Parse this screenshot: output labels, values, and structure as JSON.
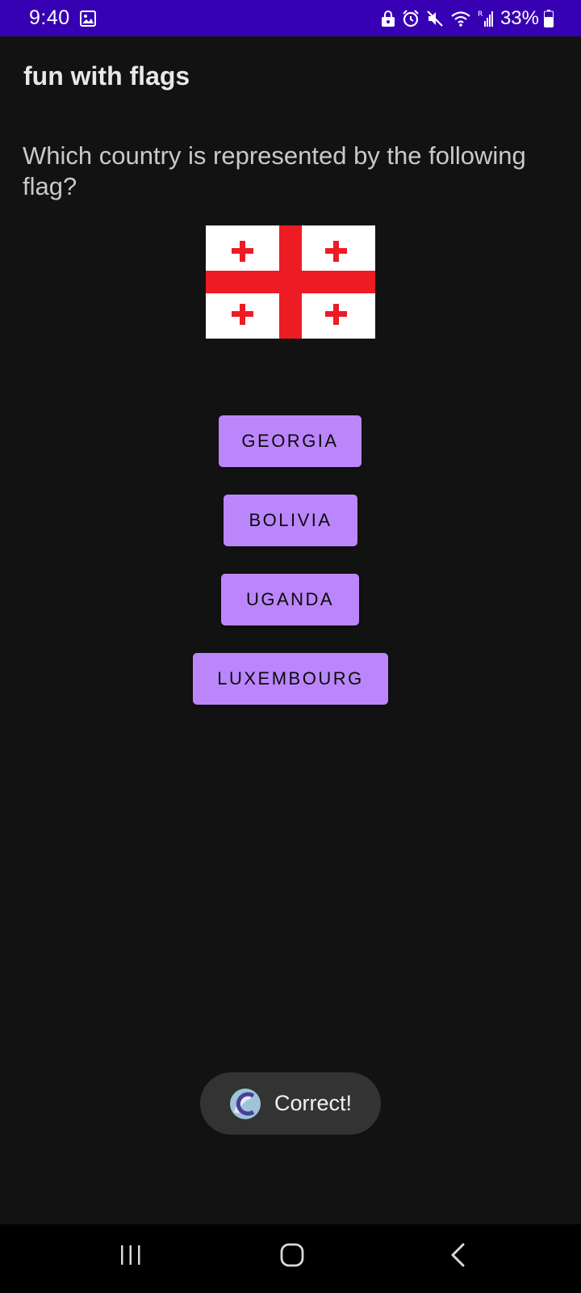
{
  "status_bar": {
    "time": "9:40",
    "left_icons": [
      "gallery-icon"
    ],
    "right_icons": [
      "vpn-lock-icon",
      "alarm-icon",
      "mute-icon",
      "wifi-icon",
      "signal-icon",
      "battery-icon"
    ],
    "battery_percent": "33%",
    "background": "#3700b3"
  },
  "app": {
    "title": "fun with flags"
  },
  "quiz": {
    "question": "Which country is represented by the following flag?",
    "flag_icon": "georgia-flag",
    "answers": [
      "GEORGIA",
      "BOLIVIA",
      "UGANDA",
      "LUXEMBOURG"
    ],
    "button_color": "#bb86fc"
  },
  "toast": {
    "message": "Correct!",
    "icon": "app-icon"
  },
  "nav_bar": {
    "buttons": [
      "recents-icon",
      "home-icon",
      "back-icon"
    ]
  }
}
